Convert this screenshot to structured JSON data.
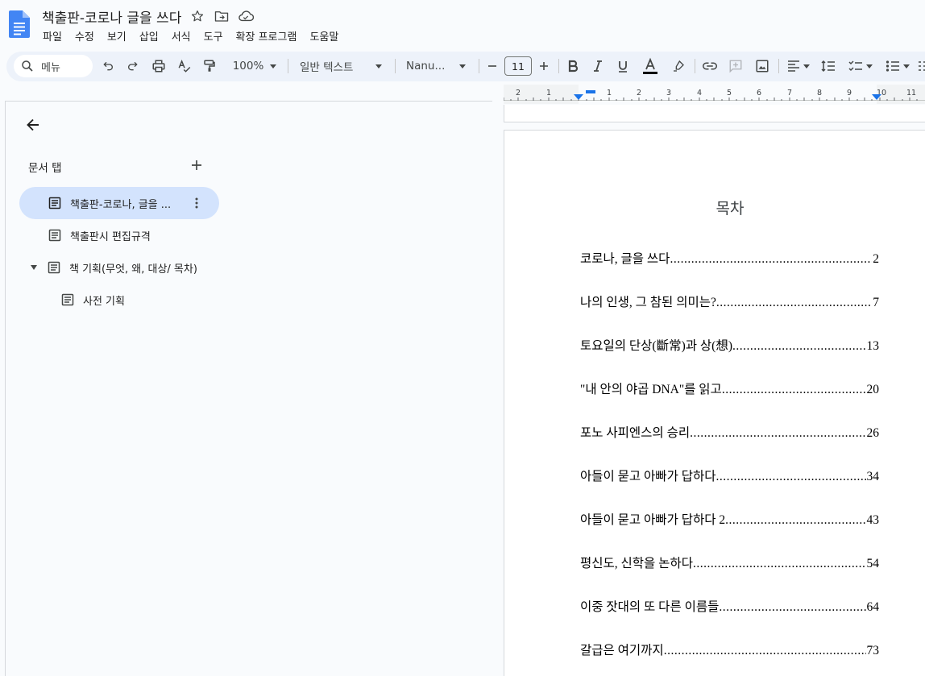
{
  "document": {
    "title": "책출판-코로나 글을 쓰다"
  },
  "menu": [
    "파일",
    "수정",
    "보기",
    "삽입",
    "서식",
    "도구",
    "확장 프로그램",
    "도움말"
  ],
  "toolbar": {
    "search_label": "메뉴",
    "zoom": "100%",
    "style": "일반 텍스트",
    "font": "Nanu...",
    "font_size": "11"
  },
  "sidebar": {
    "tabs_header": "문서 탭",
    "tabs": [
      {
        "label": "책출판-코로나, 글을 ...",
        "active": true,
        "has_children": false
      },
      {
        "label": "책출판시 편집규격",
        "active": false,
        "has_children": false
      },
      {
        "label": "책 기획(무엇, 왜, 대상/ 목차)",
        "active": false,
        "has_children": true,
        "expanded": true
      },
      {
        "label": "사전 기획",
        "active": false,
        "indent": true
      }
    ]
  },
  "ruler": {
    "labels": [
      "2",
      "1",
      "1",
      "2",
      "3",
      "4",
      "5",
      "6",
      "7",
      "8",
      "9",
      "10",
      "11"
    ]
  },
  "toc": {
    "title": "목차",
    "entries": [
      {
        "text": "코로나, 글을 쓰다",
        "page": "2"
      },
      {
        "text": "나의 인생, 그 참된 의미는?",
        "page": "7"
      },
      {
        "text": "토요일의 단상(斷常)과 상(想)",
        "page": "13"
      },
      {
        "text": "\"내 안의 야곱 DNA\"를 읽고",
        "page": "20"
      },
      {
        "text": "포노 사피엔스의 승리",
        "page": "26"
      },
      {
        "text": "아들이 묻고 아빠가 답하다",
        "page": "34"
      },
      {
        "text": "아들이 묻고 아빠가 답하다 2",
        "page": "43"
      },
      {
        "text": "평신도, 신학을 논하다",
        "page": "54"
      },
      {
        "text": "이중 잣대의 또 다른 이름들",
        "page": "64"
      },
      {
        "text": "갈급은 여기까지",
        "page": "73"
      }
    ]
  },
  "colors": {
    "accent": "#1a73e8",
    "active_tab": "#d3e3fd",
    "toolbar_bg": "#edf2fa"
  }
}
